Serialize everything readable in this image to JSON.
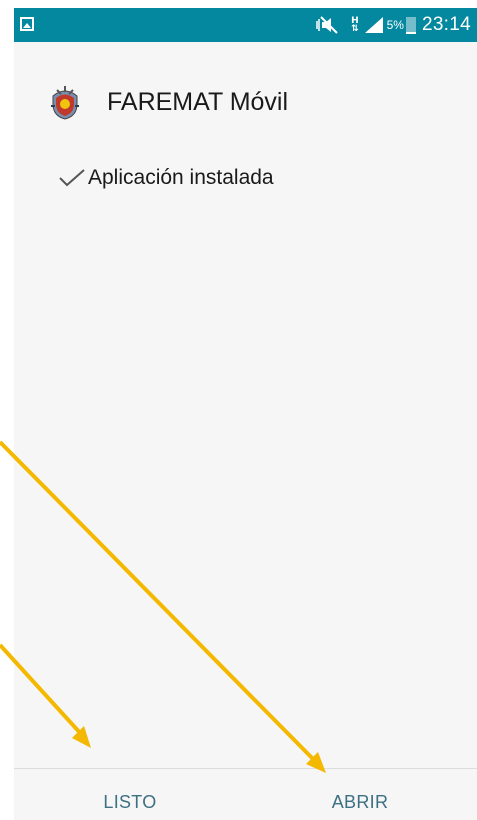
{
  "status_bar": {
    "left_icon": "gallery-icon",
    "network_type": "H",
    "battery_percent": "5%",
    "time": "23:14",
    "color": "#04889f"
  },
  "app": {
    "name": "FAREMAT Móvil",
    "icon": "faremat-crest-icon"
  },
  "install": {
    "status_text": "Aplicación instalada",
    "icon": "check-icon"
  },
  "actions": {
    "done_label": "LISTO",
    "open_label": "ABRIR",
    "color": "#3d7082"
  },
  "annotation": {
    "arrow_color": "#f5b800"
  }
}
